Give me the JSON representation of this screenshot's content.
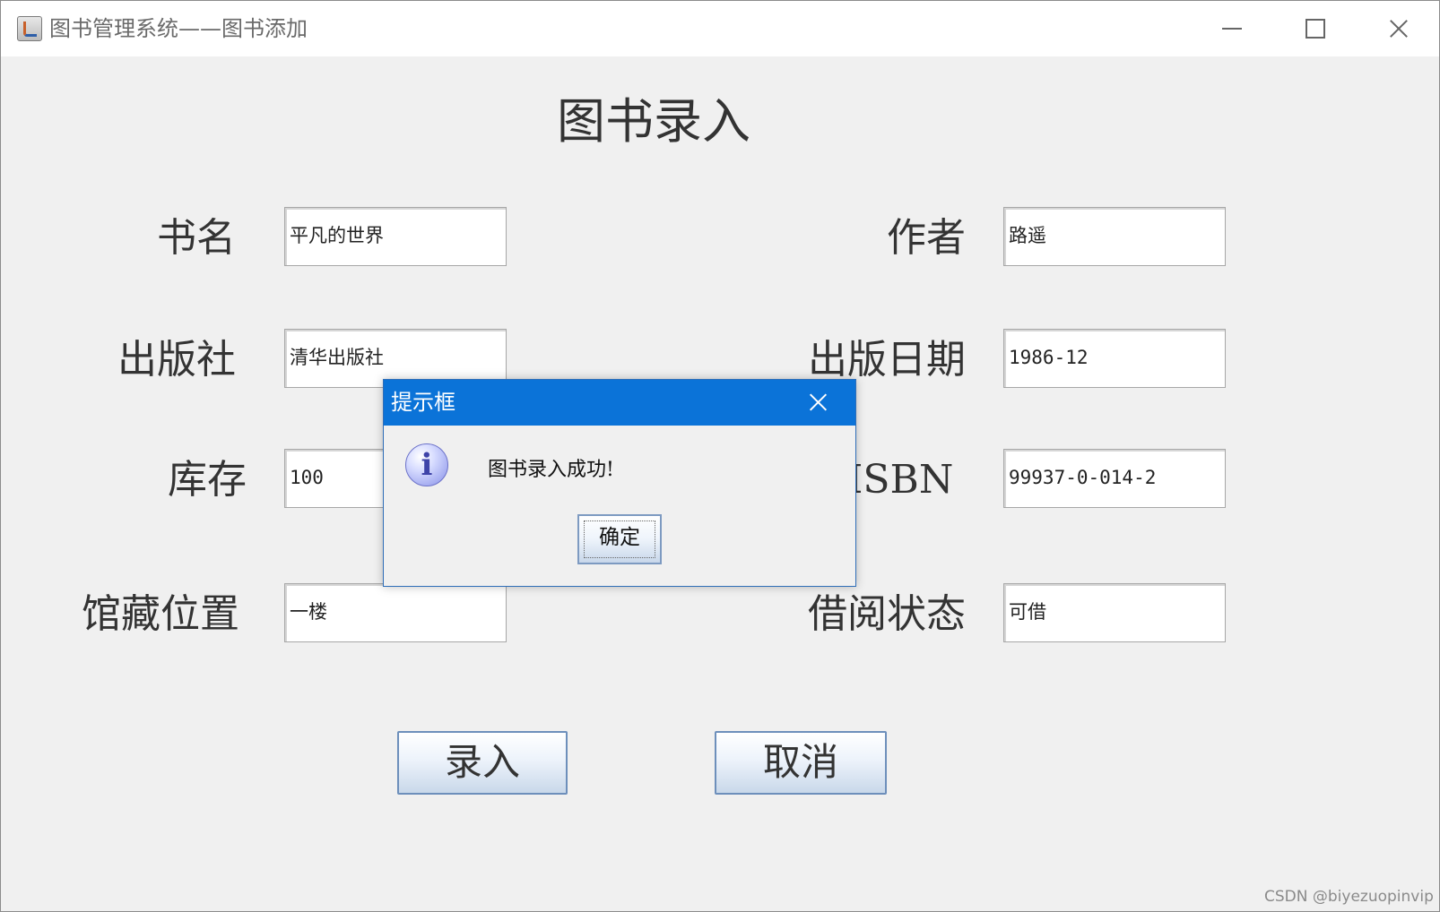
{
  "window": {
    "title": "图书管理系统——图书添加"
  },
  "form": {
    "title": "图书录入",
    "fields": {
      "book_name": {
        "label": "书名",
        "value": "平凡的世界"
      },
      "author": {
        "label": "作者",
        "value": "路遥"
      },
      "publisher": {
        "label": "出版社",
        "value": "清华出版社"
      },
      "publish_date": {
        "label": "出版日期",
        "value": "1986-12"
      },
      "stock": {
        "label": "库存",
        "value": "100"
      },
      "isbn": {
        "label": "ISBN",
        "value": "99937-0-014-2"
      },
      "location": {
        "label": "馆藏位置",
        "value": "一楼"
      },
      "borrow_status": {
        "label": "借阅状态",
        "value": "可借"
      }
    },
    "buttons": {
      "submit": "录入",
      "cancel": "取消"
    }
  },
  "dialog": {
    "title": "提示框",
    "message": "图书录入成功!",
    "ok": "确定",
    "icon": "i"
  },
  "watermark": "CSDN @biyezuopinvip"
}
